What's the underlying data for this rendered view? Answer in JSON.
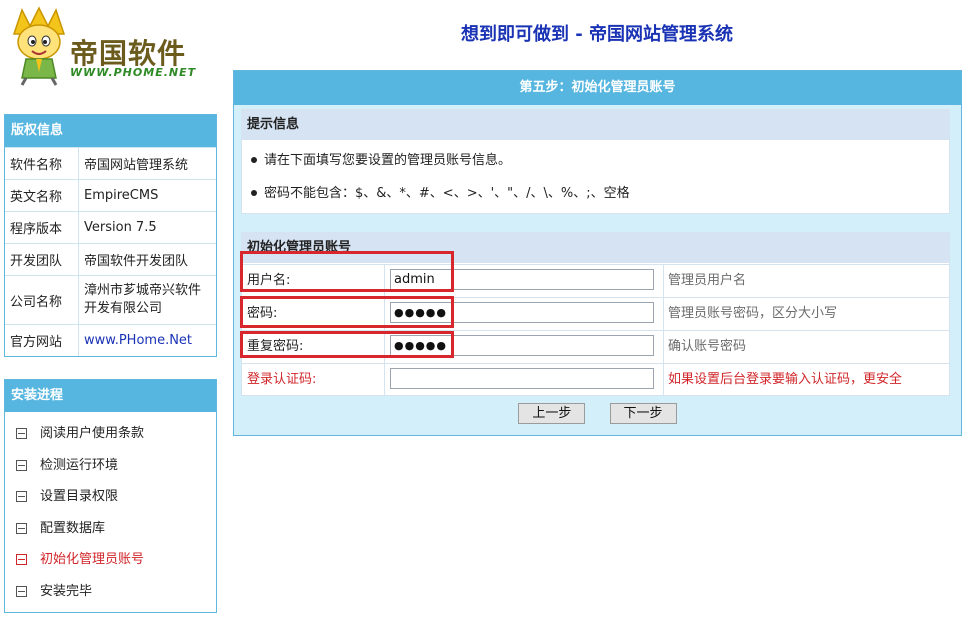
{
  "logo": {
    "brand": "帝国软件",
    "url": "WWW.PHOME.NET"
  },
  "site_title": "想到即可做到 - 帝国网站管理系统",
  "copyright": {
    "title": "版权信息",
    "rows": [
      {
        "key": "软件名称",
        "value": "帝国网站管理系统"
      },
      {
        "key": "英文名称",
        "value": "EmpireCMS"
      },
      {
        "key": "程序版本",
        "value": "Version 7.5"
      },
      {
        "key": "开发团队",
        "value": "帝国软件开发团队"
      },
      {
        "key": "公司名称",
        "value": "漳州市芗城帝兴软件开发有限公司"
      },
      {
        "key": "官方网站",
        "value": "www.PHome.Net"
      }
    ]
  },
  "progress": {
    "title": "安装进程",
    "steps": [
      {
        "label": "阅读用户使用条款"
      },
      {
        "label": "检测运行环境"
      },
      {
        "label": "设置目录权限"
      },
      {
        "label": "配置数据库"
      },
      {
        "label": "初始化管理员账号"
      },
      {
        "label": "安装完毕"
      }
    ],
    "current_index": 4
  },
  "main": {
    "title": "第五步：初始化管理员账号",
    "tips": {
      "title": "提示信息",
      "items": [
        "请在下面填写您要设置的管理员账号信息。",
        "密码不能包含：$、&、*、#、<、>、'、\"、/、\\、%、;、空格"
      ]
    },
    "form": {
      "title": "初始化管理员账号",
      "fields": [
        {
          "label": "用户名:",
          "value": "admin",
          "hint": "管理员用户名"
        },
        {
          "label": "密码:",
          "value": "●●●●●",
          "hint": "管理员账号密码，区分大小写"
        },
        {
          "label": "重复密码:",
          "value": "●●●●●",
          "hint": "确认账号密码"
        },
        {
          "label": "登录认证码:",
          "value": "",
          "hint": "如果设置后台登录要输入认证码，更安全"
        }
      ]
    },
    "buttons": {
      "prev": "上一步",
      "next": "下一步"
    }
  },
  "colors": {
    "header_blue": "#56b6e0",
    "title_blue": "#1a33b5",
    "highlight_red": "#d8262d",
    "active_red": "#d0262a"
  }
}
